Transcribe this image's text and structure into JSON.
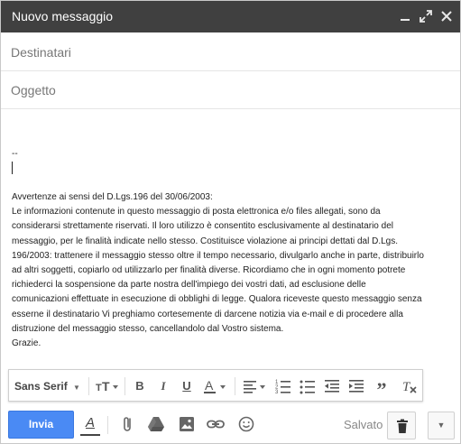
{
  "window": {
    "title": "Nuovo messaggio"
  },
  "compose": {
    "to_placeholder": "Destinatari",
    "subject_placeholder": "Oggetto",
    "signature_dash": "--",
    "body_lines": [
      "Avvertenze ai sensi del D.Lgs.196 del 30/06/2003:",
      "Le informazioni contenute in questo messaggio di posta elettronica  e/o files allegati, sono da",
      "considerarsi strettamente riservati. Il loro utilizzo è consentito esclusivamente al destinatario del",
      "messaggio, per le finalità indicate nello stesso. Costituisce violazione ai principi dettati dal D.Lgs.",
      "196/2003: trattenere il messaggio stesso oltre il tempo necessario, divulgarlo anche in parte, distribuirlo",
      "ad altri soggetti, copiarlo od utilizzarlo per finalità diverse. Ricordiamo che in ogni momento potrete",
      "richiederci la sospensione da parte nostra dell'impiego dei vostri dati, ad esclusione delle",
      "comunicazioni effettuate in esecuzione di obblighi di legge. Qualora riceveste questo messaggio senza",
      "esserne il destinatario Vi preghiamo cortesemente di darcene notizia via e-mail e di procedere alla",
      "distruzione del messaggio stesso, cancellandolo dal Vostro sistema.",
      "Grazie."
    ]
  },
  "formatting": {
    "font": "Sans Serif"
  },
  "footer": {
    "send_label": "Invia",
    "saved_status": "Salvato"
  }
}
